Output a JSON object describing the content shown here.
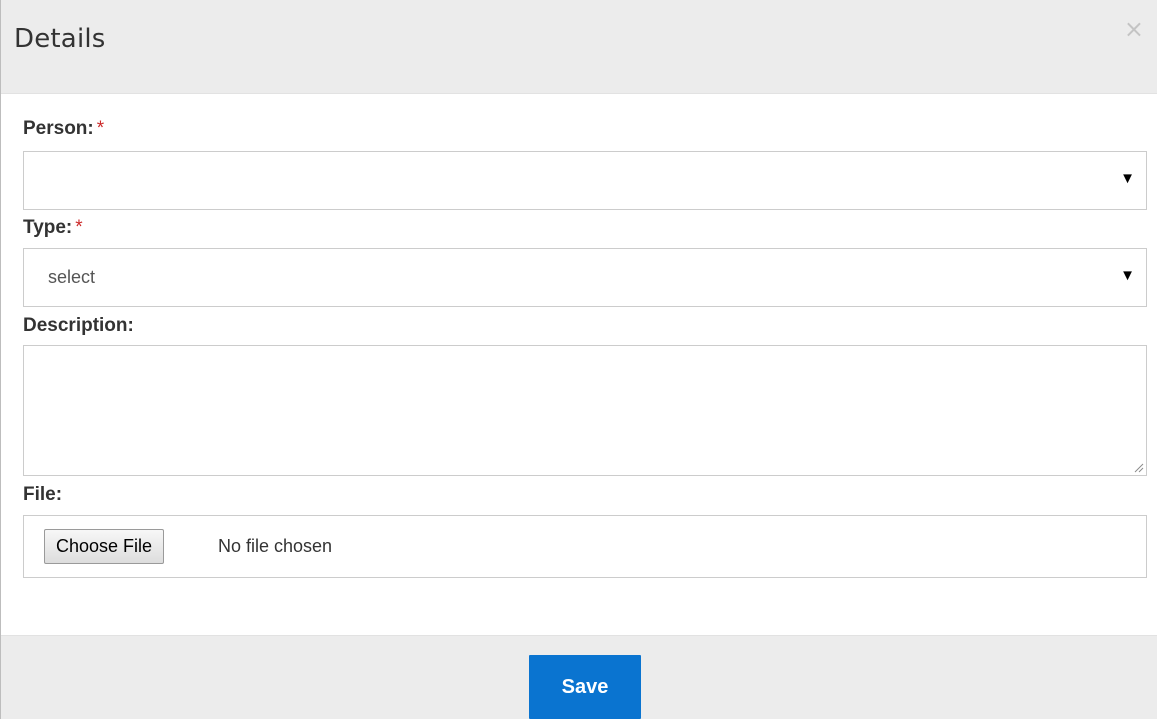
{
  "header": {
    "title": "Details",
    "close_symbol": "×"
  },
  "form": {
    "person": {
      "label": "Person:",
      "required_mark": "*",
      "value": ""
    },
    "type": {
      "label": "Type:",
      "required_mark": "*",
      "value": "select"
    },
    "description": {
      "label": "Description:",
      "value": ""
    },
    "file": {
      "label": "File:",
      "button_label": "Choose File",
      "status": "No file chosen"
    },
    "dropdown_caret": "▼"
  },
  "footer": {
    "save_label": "Save"
  },
  "colors": {
    "header_bg": "#ececec",
    "primary_button": "#0a74d0",
    "required_star": "#cc2a2a"
  },
  "icons": {
    "close": "close-icon",
    "caret": "chevron-down-icon",
    "resize": "resize-grip-icon"
  }
}
